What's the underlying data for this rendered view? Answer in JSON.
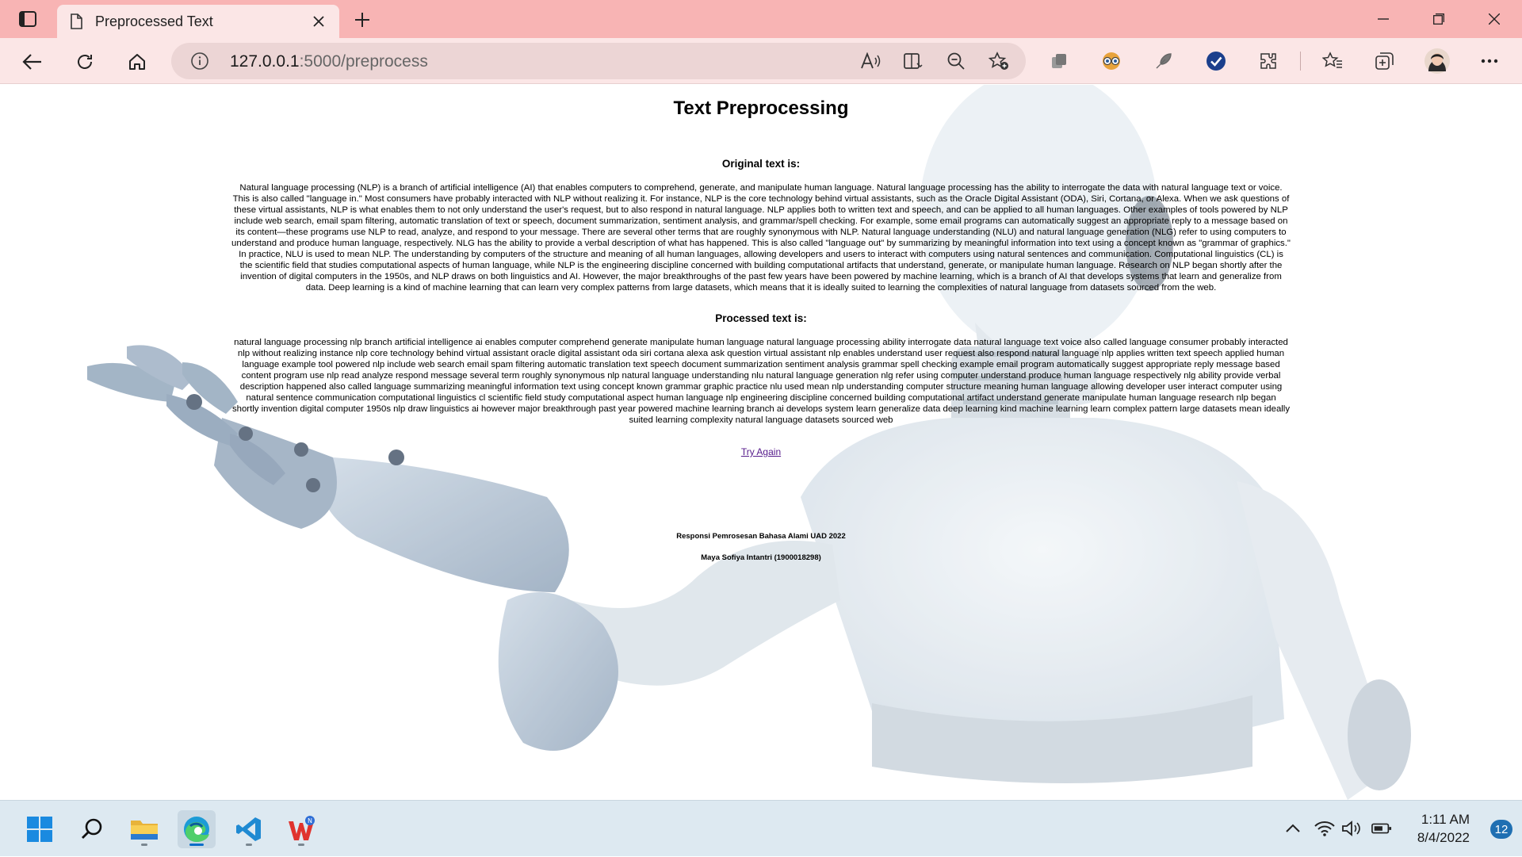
{
  "browser": {
    "tab_title": "Preprocessed Text",
    "url_host": "127.0.0.1",
    "url_rest": ":5000/preprocess"
  },
  "page": {
    "title": "Text Preprocessing",
    "original_heading": "Original text is:",
    "original_text": "Natural language processing (NLP) is a branch of artificial intelligence (AI) that enables computers to comprehend, generate, and manipulate human language. Natural language processing has the ability to interrogate the data with natural language text or voice. This is also called \"language in.\" Most consumers have probably interacted with NLP without realizing it. For instance, NLP is the core technology behind virtual assistants, such as the Oracle Digital Assistant (ODA), Siri, Cortana, or Alexa. When we ask questions of these virtual assistants, NLP is what enables them to not only understand the user's request, but to also respond in natural language. NLP applies both to written text and speech, and can be applied to all human languages. Other examples of tools powered by NLP include web search, email spam filtering, automatic translation of text or speech, document summarization, sentiment analysis, and grammar/spell checking. For example, some email programs can automatically suggest an appropriate reply to a message based on its content—these programs use NLP to read, analyze, and respond to your message. There are several other terms that are roughly synonymous with NLP. Natural language understanding (NLU) and natural language generation (NLG) refer to using computers to understand and produce human language, respectively. NLG has the ability to provide a verbal description of what has happened. This is also called \"language out\" by summarizing by meaningful information into text using a concept known as \"grammar of graphics.\" In practice, NLU is used to mean NLP. The understanding by computers of the structure and meaning of all human languages, allowing developers and users to interact with computers using natural sentences and communication. Computational linguistics (CL) is the scientific field that studies computational aspects of human language, while NLP is the engineering discipline concerned with building computational artifacts that understand, generate, or manipulate human language. Research on NLP began shortly after the invention of digital computers in the 1950s, and NLP draws on both linguistics and AI. However, the major breakthroughs of the past few years have been powered by machine learning, which is a branch of AI that develops systems that learn and generalize from data. Deep learning is a kind of machine learning that can learn very complex patterns from large datasets, which means that it is ideally suited to learning the complexities of natural language from datasets sourced from the web.",
    "processed_heading": "Processed text is:",
    "processed_text": "natural language processing nlp branch artificial intelligence ai enables computer comprehend generate manipulate human language natural language processing ability interrogate data natural language text voice also called language consumer probably interacted nlp without realizing instance nlp core technology behind virtual assistant oracle digital assistant oda siri cortana alexa ask question virtual assistant nlp enables understand user request also respond natural language nlp applies written text speech applied human language example tool powered nlp include web search email spam filtering automatic translation text speech document summarization sentiment analysis grammar spell checking example email program automatically suggest appropriate reply message based content program use nlp read analyze respond message several term roughly synonymous nlp natural language understanding nlu natural language generation nlg refer using computer understand produce human language respectively nlg ability provide verbal description happened also called language summarizing meaningful information text using concept known grammar graphic practice nlu used mean nlp understanding computer structure meaning human language allowing developer user interact computer using natural sentence communication computational linguistics cl scientific field study computational aspect human language nlp engineering discipline concerned building computational artifact understand generate manipulate human language research nlp began shortly invention digital computer 1950s nlp draw linguistics ai however major breakthrough past year powered machine learning branch ai develops system learn generalize data deep learning kind machine learning learn complex pattern large datasets mean ideally suited learning complexity natural language datasets sourced web",
    "try_again": "Try Again",
    "footer_line1": "Responsi Pemrosesan Bahasa Alami UAD 2022",
    "footer_line2": "Maya Sofiya Intantri (1900018298)"
  },
  "taskbar": {
    "time": "1:11 AM",
    "date": "8/4/2022",
    "notification_count": "12"
  },
  "colors": {
    "titlebar": "#f8b4b4",
    "toolbar": "#fbe6e6",
    "link": "#551a8b",
    "taskbar": "#dde9f1"
  }
}
